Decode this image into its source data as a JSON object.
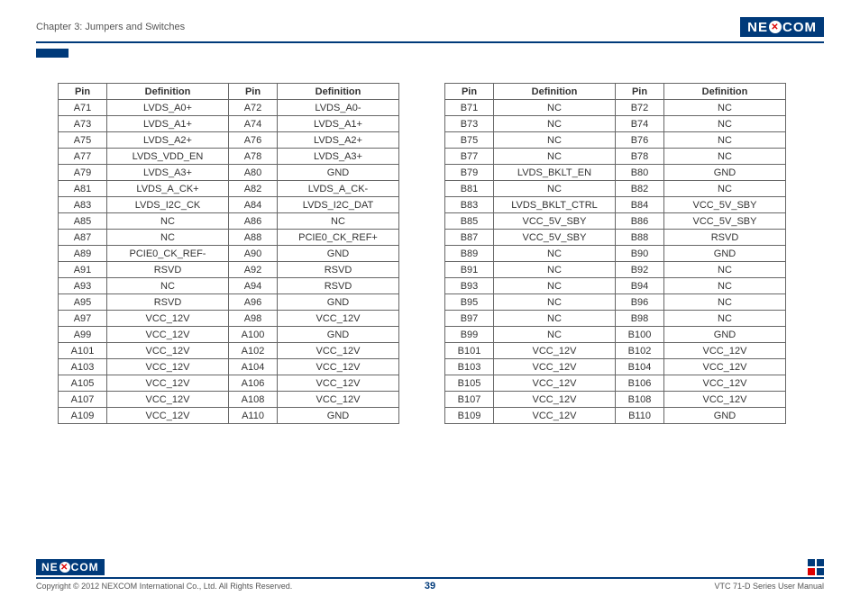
{
  "header": {
    "chapter": "Chapter 3: Jumpers and Switches",
    "brand_left": "NE",
    "brand_right": "COM"
  },
  "tables": {
    "headers": {
      "pin": "Pin",
      "def": "Definition"
    },
    "left": [
      [
        "A71",
        "LVDS_A0+",
        "A72",
        "LVDS_A0-"
      ],
      [
        "A73",
        "LVDS_A1+",
        "A74",
        "LVDS_A1+"
      ],
      [
        "A75",
        "LVDS_A2+",
        "A76",
        "LVDS_A2+"
      ],
      [
        "A77",
        "LVDS_VDD_EN",
        "A78",
        "LVDS_A3+"
      ],
      [
        "A79",
        "LVDS_A3+",
        "A80",
        "GND"
      ],
      [
        "A81",
        "LVDS_A_CK+",
        "A82",
        "LVDS_A_CK-"
      ],
      [
        "A83",
        "LVDS_I2C_CK",
        "A84",
        "LVDS_I2C_DAT"
      ],
      [
        "A85",
        "NC",
        "A86",
        "NC"
      ],
      [
        "A87",
        "NC",
        "A88",
        "PCIE0_CK_REF+"
      ],
      [
        "A89",
        "PCIE0_CK_REF-",
        "A90",
        "GND"
      ],
      [
        "A91",
        "RSVD",
        "A92",
        "RSVD"
      ],
      [
        "A93",
        "NC",
        "A94",
        "RSVD"
      ],
      [
        "A95",
        "RSVD",
        "A96",
        "GND"
      ],
      [
        "A97",
        "VCC_12V",
        "A98",
        "VCC_12V"
      ],
      [
        "A99",
        "VCC_12V",
        "A100",
        "GND"
      ],
      [
        "A101",
        "VCC_12V",
        "A102",
        "VCC_12V"
      ],
      [
        "A103",
        "VCC_12V",
        "A104",
        "VCC_12V"
      ],
      [
        "A105",
        "VCC_12V",
        "A106",
        "VCC_12V"
      ],
      [
        "A107",
        "VCC_12V",
        "A108",
        "VCC_12V"
      ],
      [
        "A109",
        "VCC_12V",
        "A110",
        "GND"
      ]
    ],
    "right": [
      [
        "B71",
        "NC",
        "B72",
        "NC"
      ],
      [
        "B73",
        "NC",
        "B74",
        "NC"
      ],
      [
        "B75",
        "NC",
        "B76",
        "NC"
      ],
      [
        "B77",
        "NC",
        "B78",
        "NC"
      ],
      [
        "B79",
        "LVDS_BKLT_EN",
        "B80",
        "GND"
      ],
      [
        "B81",
        "NC",
        "B82",
        "NC"
      ],
      [
        "B83",
        "LVDS_BKLT_CTRL",
        "B84",
        "VCC_5V_SBY"
      ],
      [
        "B85",
        "VCC_5V_SBY",
        "B86",
        "VCC_5V_SBY"
      ],
      [
        "B87",
        "VCC_5V_SBY",
        "B88",
        "RSVD"
      ],
      [
        "B89",
        "NC",
        "B90",
        "GND"
      ],
      [
        "B91",
        "NC",
        "B92",
        "NC"
      ],
      [
        "B93",
        "NC",
        "B94",
        "NC"
      ],
      [
        "B95",
        "NC",
        "B96",
        "NC"
      ],
      [
        "B97",
        "NC",
        "B98",
        "NC"
      ],
      [
        "B99",
        "NC",
        "B100",
        "GND"
      ],
      [
        "B101",
        "VCC_12V",
        "B102",
        "VCC_12V"
      ],
      [
        "B103",
        "VCC_12V",
        "B104",
        "VCC_12V"
      ],
      [
        "B105",
        "VCC_12V",
        "B106",
        "VCC_12V"
      ],
      [
        "B107",
        "VCC_12V",
        "B108",
        "VCC_12V"
      ],
      [
        "B109",
        "VCC_12V",
        "B110",
        "GND"
      ]
    ]
  },
  "footer": {
    "copyright": "Copyright © 2012 NEXCOM International Co., Ltd. All Rights Reserved.",
    "page": "39",
    "doc": "VTC 71-D Series User Manual"
  }
}
